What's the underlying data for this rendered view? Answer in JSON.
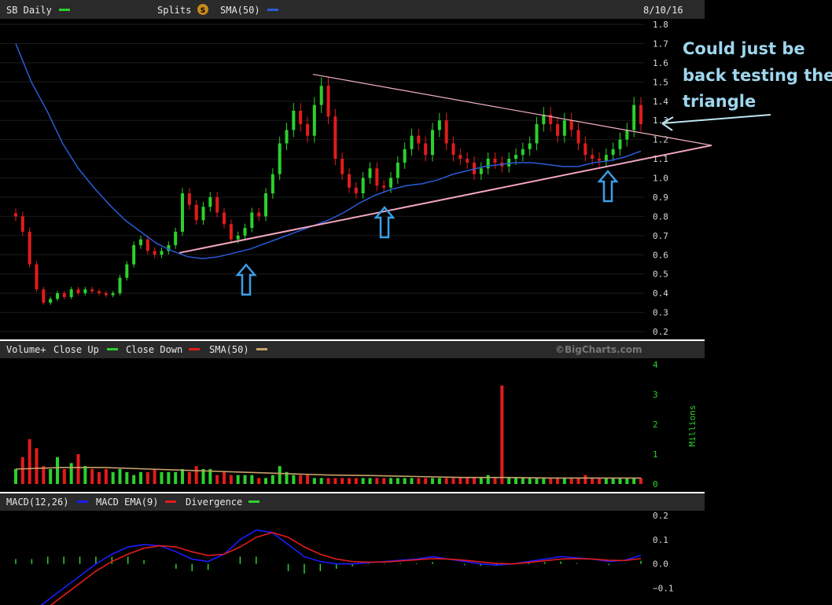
{
  "header": {
    "symbol": "SB Daily",
    "splits_label": "Splits",
    "splits_badge": "S",
    "sma_label": "SMA(50)",
    "date": "8/10/16"
  },
  "volume_header": {
    "label": "Volume+",
    "close_up": "Close Up",
    "close_down": "Close Down",
    "sma": "SMA(50)",
    "watermark": "©BigCharts.com",
    "unit": "Millions"
  },
  "macd_header": {
    "label": "MACD(12,26)",
    "ema": "MACD EMA(9)",
    "divergence": "Divergence"
  },
  "annotation": {
    "lines": [
      "Could just be",
      "back testing the",
      "triangle"
    ]
  },
  "colors": {
    "up": "#2bd12b",
    "down": "#e31b1b",
    "sma_price": "#2a5bd7",
    "sma_volume": "#c9a26a",
    "macd": "#1c1cff",
    "macd_ema": "#e31b1b",
    "divergence": "#2bd12b",
    "trendline_upper": "#f2b3c2",
    "trendline_lower": "#f4a6c0",
    "arrows": "#3a9fe8",
    "annotation": "#9fd6ee"
  },
  "chart_data": [
    {
      "type": "candlestick",
      "title": "SB Daily",
      "date": "8/10/16",
      "ylim": [
        0.15,
        1.85
      ],
      "y_ticks": [
        "1.8",
        "1.7",
        "1.6",
        "1.5",
        "1.4",
        "1.3",
        "1.2",
        "1.1",
        "1.0",
        "0.9",
        "0.8",
        "0.7",
        "0.6",
        "0.5",
        "0.4",
        "0.3",
        "0.2"
      ],
      "close": [
        0.8,
        0.72,
        0.55,
        0.42,
        0.35,
        0.37,
        0.4,
        0.38,
        0.42,
        0.4,
        0.42,
        0.41,
        0.4,
        0.39,
        0.4,
        0.48,
        0.55,
        0.65,
        0.68,
        0.62,
        0.6,
        0.62,
        0.65,
        0.72,
        0.92,
        0.86,
        0.78,
        0.85,
        0.9,
        0.82,
        0.76,
        0.68,
        0.7,
        0.74,
        0.82,
        0.8,
        0.92,
        1.02,
        1.18,
        1.25,
        1.35,
        1.28,
        1.22,
        1.38,
        1.48,
        1.32,
        1.1,
        1.02,
        0.95,
        0.92,
        1.0,
        1.05,
        0.96,
        0.95,
        1.0,
        1.08,
        1.15,
        1.22,
        1.18,
        1.12,
        1.25,
        1.3,
        1.18,
        1.12,
        1.1,
        1.08,
        1.02,
        1.05,
        1.1,
        1.08,
        1.06,
        1.1,
        1.12,
        1.15,
        1.18,
        1.28,
        1.33,
        1.28,
        1.22,
        1.3,
        1.25,
        1.18,
        1.12,
        1.1,
        1.09,
        1.12,
        1.15,
        1.2,
        1.25,
        1.38,
        1.28
      ],
      "sma50": [
        1.7,
        1.5,
        1.35,
        1.18,
        1.05,
        0.95,
        0.86,
        0.78,
        0.72,
        0.66,
        0.62,
        0.59,
        0.58,
        0.59,
        0.61,
        0.63,
        0.66,
        0.69,
        0.72,
        0.75,
        0.78,
        0.82,
        0.87,
        0.91,
        0.94,
        0.96,
        0.97,
        0.99,
        1.02,
        1.04,
        1.06,
        1.07,
        1.08,
        1.08,
        1.07,
        1.06,
        1.06,
        1.08,
        1.09,
        1.11,
        1.14
      ],
      "sma50_x": [
        0,
        3,
        6,
        9,
        12,
        15,
        18,
        21,
        24,
        27,
        30,
        33,
        36,
        39,
        42,
        45,
        48,
        51,
        54,
        57,
        60,
        63,
        66,
        69,
        72,
        75,
        78,
        81,
        84,
        87,
        90,
        93,
        96,
        99,
        102,
        105,
        108,
        111,
        114,
        117,
        120
      ],
      "trendline_upper": [
        [
          0,
          1.54
        ],
        [
          100,
          1.17
        ]
      ],
      "trendline_lower": [
        [
          0,
          0.61
        ],
        [
          100,
          1.17
        ]
      ]
    },
    {
      "type": "bar",
      "title": "Volume+",
      "unit": "Millions",
      "ylim": [
        0,
        4
      ],
      "y_ticks": [
        "4",
        "3",
        "2",
        "1",
        "0"
      ],
      "values": [
        0.5,
        0.9,
        1.5,
        1.2,
        0.6,
        0.5,
        0.9,
        0.5,
        0.7,
        1.0,
        0.6,
        0.5,
        0.4,
        0.5,
        0.4,
        0.5,
        0.4,
        0.3,
        0.4,
        0.4,
        0.5,
        0.4,
        0.4,
        0.4,
        0.5,
        0.4,
        0.6,
        0.5,
        0.5,
        0.3,
        0.4,
        0.3,
        0.3,
        0.3,
        0.3,
        0.2,
        0.2,
        0.3,
        0.6,
        0.4,
        0.3,
        0.3,
        0.3,
        0.2,
        0.2,
        0.2,
        0.2,
        0.2,
        0.2,
        0.2,
        0.2,
        0.2,
        0.2,
        0.2,
        0.2,
        0.2,
        0.2,
        0.2,
        0.2,
        0.2,
        0.2,
        0.2,
        0.2,
        0.2,
        0.2,
        0.2,
        0.2,
        0.2,
        0.3,
        0.2,
        3.3,
        0.2,
        0.2,
        0.2,
        0.2,
        0.2,
        0.2,
        0.2,
        0.2,
        0.2,
        0.2,
        0.2,
        0.3,
        0.2,
        0.2,
        0.2,
        0.2,
        0.2,
        0.2,
        0.2,
        0.2
      ],
      "sma50": [
        0.5,
        0.55,
        0.55,
        0.5,
        0.45,
        0.4,
        0.35,
        0.3,
        0.28,
        0.25,
        0.22,
        0.22,
        0.2,
        0.2,
        0.2
      ]
    },
    {
      "type": "line",
      "title": "MACD(12,26)",
      "ylim": [
        -0.17,
        0.22
      ],
      "y_ticks": [
        "0.2",
        "0.1",
        "0.0",
        "−0.1"
      ],
      "series": [
        {
          "name": "MACD(12,26)",
          "values": [
            -0.25,
            -0.2,
            -0.15,
            -0.1,
            -0.05,
            0.0,
            0.04,
            0.07,
            0.08,
            0.075,
            0.05,
            0.02,
            0.01,
            0.04,
            0.1,
            0.14,
            0.13,
            0.08,
            0.03,
            0.01,
            0.0,
            0.0,
            0.005,
            0.01,
            0.015,
            0.02,
            0.03,
            0.02,
            0.01,
            0.0,
            -0.005,
            0.0,
            0.01,
            0.02,
            0.03,
            0.025,
            0.02,
            0.01,
            0.015,
            0.035
          ]
        },
        {
          "name": "MACD EMA(9)",
          "values": [
            -0.27,
            -0.22,
            -0.18,
            -0.13,
            -0.08,
            -0.03,
            0.01,
            0.04,
            0.065,
            0.075,
            0.07,
            0.05,
            0.035,
            0.04,
            0.07,
            0.11,
            0.13,
            0.11,
            0.07,
            0.04,
            0.02,
            0.01,
            0.007,
            0.008,
            0.012,
            0.017,
            0.022,
            0.02,
            0.015,
            0.008,
            0.002,
            0.0,
            0.006,
            0.013,
            0.02,
            0.022,
            0.02,
            0.015,
            0.014,
            0.022
          ]
        },
        {
          "name": "Divergence",
          "values": [
            0.02,
            0.02,
            0.03,
            0.03,
            0.03,
            0.03,
            0.03,
            0.03,
            0.015,
            0.0,
            -0.02,
            -0.03,
            -0.025,
            0.0,
            0.03,
            0.03,
            0.0,
            -0.03,
            -0.04,
            -0.03,
            -0.02,
            -0.01,
            -0.002,
            0.002,
            0.003,
            0.003,
            0.008,
            0.0,
            -0.005,
            -0.008,
            -0.007,
            0.0,
            0.004,
            0.007,
            0.01,
            0.003,
            0.0,
            -0.005,
            0.001,
            0.013
          ]
        }
      ]
    }
  ]
}
